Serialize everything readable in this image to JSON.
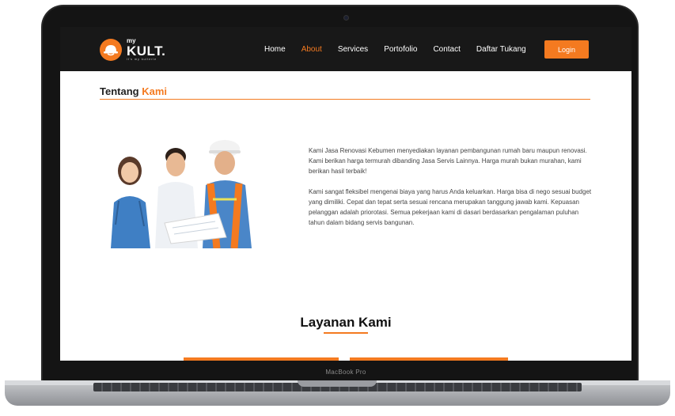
{
  "device": {
    "label": "MacBook Pro"
  },
  "nav": {
    "logo": {
      "my": "my",
      "brand": "KULT.",
      "tagline": "it's my kulterie"
    },
    "items": [
      {
        "label": "Home",
        "active": false
      },
      {
        "label": "About",
        "active": true
      },
      {
        "label": "Services",
        "active": false
      },
      {
        "label": "Portofolio",
        "active": false
      },
      {
        "label": "Contact",
        "active": false
      },
      {
        "label": "Daftar Tukang",
        "active": false
      }
    ],
    "login_label": "Login"
  },
  "about": {
    "title_prefix": "Tentang",
    "title_accent": "Kami",
    "paragraph1": "Kami Jasa Renovasi Kebumen menyediakan layanan pembangunan rumah baru maupun renovasi. Kami berikan harga termurah dibanding Jasa Servis Lainnya. Harga murah bukan murahan, kami berikan hasil terbaik!",
    "paragraph2": "Kami sangat fleksibel mengenai biaya yang harus Anda keluarkan. Harga bisa di nego sesuai budget yang dimiliki. Cepat dan tepat serta sesuai rencana merupakan tanggung jawab kami. Kepuasan pelanggan adalah priorotasi. Semua pekerjaan kami di dasari berdasarkan pengalaman puluhan tahun dalam bidang servis bangunan."
  },
  "services": {
    "title": "Layanan Kami"
  },
  "colors": {
    "accent": "#f47a20",
    "nav_bg": "#181818"
  }
}
